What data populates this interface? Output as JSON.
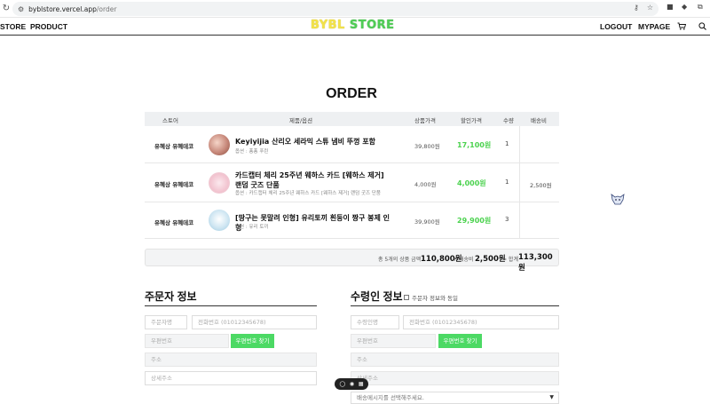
{
  "browser": {
    "url_domain": "byblstore.vercel.app",
    "url_path": "/order"
  },
  "nav": {
    "left_items": [
      "STORE",
      "PRODUCT"
    ],
    "logo_part1": "BYBL",
    "logo_part2": "STORE",
    "right_items": [
      "LOGOUT",
      "MYPAGE"
    ]
  },
  "page_title": "ORDER",
  "table": {
    "headers": [
      "스토어",
      "제품/옵션",
      "상품가격",
      "할인가격",
      "수량",
      "배송비"
    ],
    "rows": [
      {
        "store": "유혜상 유혜데코",
        "name": "Keyiyijia 산리오 세라믹 스튜 냄비 뚜껑 포함",
        "option": "옵션 : 퐁퐁 푸린",
        "price": "39,800원",
        "sale": "17,100원",
        "qty": "1"
      },
      {
        "store": "유혜상 유혜데코",
        "name": "카드캡터 체리 25주년 웨하스 카드 [웨하스 제거] 랜덤 굿즈 단품",
        "option": "옵션 : 카드캡터 체리 25주년 웨하스 카드 [웨하스 제거] 랜덤 굿즈 단품",
        "price": "4,000원",
        "sale": "4,000원",
        "qty": "1"
      },
      {
        "store": "유혜상 유혜데코",
        "name": "[땅구는 못말려 인형] 유리토끼 흰둥이 짱구 봉제 인형",
        "option": "옵션 : 유리 토끼",
        "price": "39,900원",
        "sale": "29,900원",
        "qty": "3"
      }
    ],
    "shipping": "2,500원"
  },
  "summary": {
    "label_total": "총 5개의 상품 금액",
    "total": "110,800원",
    "label_ship": "+ 배송비",
    "ship": "2,500원",
    "label_sum": "= 합계",
    "sum": "113,300원"
  },
  "orderer": {
    "title": "주문자 정보",
    "name_ph": "주문자명",
    "phone_ph": "전화번호 (01012345678)",
    "zip_ph": "우편번호",
    "zip_btn": "우편번호 찾기",
    "addr_ph": "주소",
    "addr2_ph": "상세주소"
  },
  "receiver": {
    "title": "수령인 정보",
    "same_label": "주문자 정보와 동일",
    "name_ph": "수령인명",
    "phone_ph": "전화번호 (01012345678)",
    "zip_ph": "우편번호",
    "zip_btn": "우편번호 찾기",
    "addr_ph": "주소",
    "addr2_ph": "상세주소",
    "delivery_msg": "배송메시지를 선택해주세요."
  },
  "colors": {
    "accent_green": "#4cd964",
    "sale_green": "#4cd24f"
  }
}
